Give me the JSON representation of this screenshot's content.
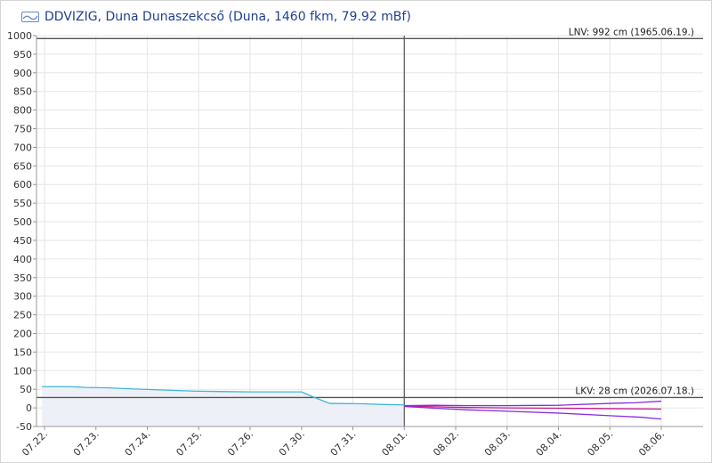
{
  "header": {
    "logo_icon": "ddvizig-logo-icon",
    "title": "DDVIZIG, Duna Dunaszekcső (Duna, 1460 fkm, 79.92 mBf)"
  },
  "chart_data": {
    "type": "line",
    "ylim": [
      -50,
      1000
    ],
    "yticks": [
      -50,
      0,
      50,
      100,
      150,
      200,
      250,
      300,
      350,
      400,
      450,
      500,
      550,
      600,
      650,
      700,
      750,
      800,
      850,
      900,
      950,
      1000
    ],
    "categories": [
      "07.22.",
      "07.23.",
      "07.24.",
      "07.25.",
      "07.26.",
      "07.30.",
      "07.31.",
      "08.01.",
      "08.02.",
      "08.03.",
      "08.04.",
      "08.05.",
      "08.06."
    ],
    "grid": true,
    "reference_lines": [
      {
        "label": "LNV: 992 cm (1965.06.19.)",
        "value": 992
      },
      {
        "label": "LKV: 28 cm (2026.07.18.)",
        "value": 28
      }
    ],
    "now_marker_category": "08.01.",
    "series": [
      {
        "role": "measured",
        "color": "#3fb6d8",
        "points": [
          [
            -0.05,
            57
          ],
          [
            0.5,
            57
          ],
          [
            0.8,
            55
          ],
          [
            1.2,
            54
          ],
          [
            1.7,
            51
          ],
          [
            2.3,
            48
          ],
          [
            2.9,
            45
          ],
          [
            3.4,
            44
          ],
          [
            4.0,
            43
          ],
          [
            4.6,
            43
          ],
          [
            5.0,
            43
          ],
          [
            5.25,
            28
          ],
          [
            5.55,
            12
          ],
          [
            6.2,
            11
          ],
          [
            6.6,
            9
          ],
          [
            7.0,
            8
          ]
        ]
      },
      {
        "role": "forecast",
        "color": "#c21a8c",
        "points": [
          [
            7.0,
            5
          ],
          [
            7.6,
            3
          ],
          [
            8.2,
            1
          ],
          [
            9.0,
            0
          ],
          [
            10.0,
            -1
          ],
          [
            11.0,
            -2
          ],
          [
            12.0,
            -3
          ]
        ]
      },
      {
        "role": "forecast-upper",
        "color": "#8a2be2",
        "points": [
          [
            7.0,
            6
          ],
          [
            7.6,
            7
          ],
          [
            8.2,
            6
          ],
          [
            9.0,
            6
          ],
          [
            10.0,
            7
          ],
          [
            11.0,
            12
          ],
          [
            11.5,
            14
          ],
          [
            12.0,
            18
          ]
        ]
      },
      {
        "role": "forecast-lower",
        "color": "#8a2be2",
        "points": [
          [
            7.0,
            4
          ],
          [
            7.6,
            -1
          ],
          [
            8.2,
            -5
          ],
          [
            9.0,
            -9
          ],
          [
            10.0,
            -14
          ],
          [
            11.0,
            -21
          ],
          [
            11.6,
            -25
          ],
          [
            12.0,
            -30
          ]
        ]
      }
    ]
  }
}
